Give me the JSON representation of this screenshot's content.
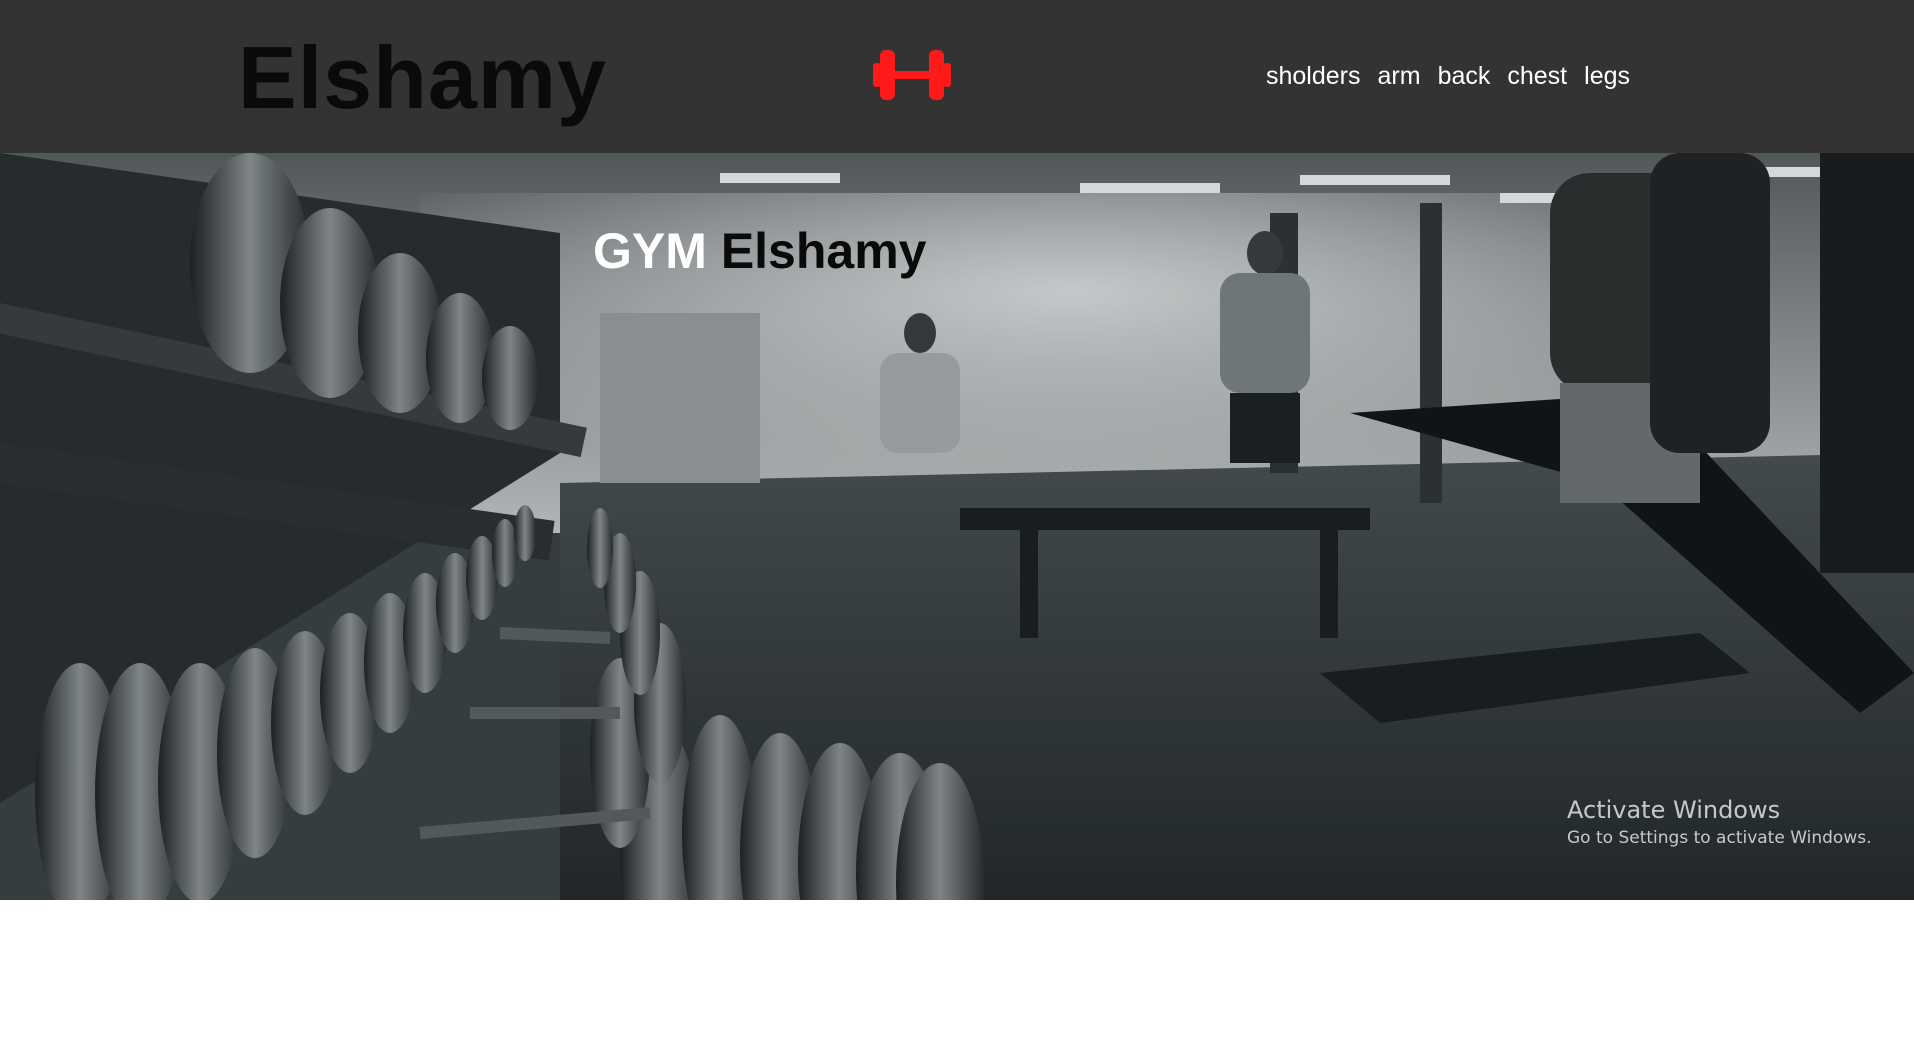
{
  "header": {
    "brand": "Elshamy",
    "logo_icon": "dumbbell-icon",
    "logo_color": "#ff1a1a",
    "background": "#333333",
    "nav": [
      {
        "label": "sholders"
      },
      {
        "label": "arm"
      },
      {
        "label": "back"
      },
      {
        "label": "chest"
      },
      {
        "label": "legs"
      }
    ]
  },
  "hero": {
    "title_part1": "GYM",
    "title_part2": "Elshamy",
    "image": "gym-photo"
  },
  "watermark": {
    "title": "Activate Windows",
    "subtitle": "Go to Settings to activate Windows."
  }
}
